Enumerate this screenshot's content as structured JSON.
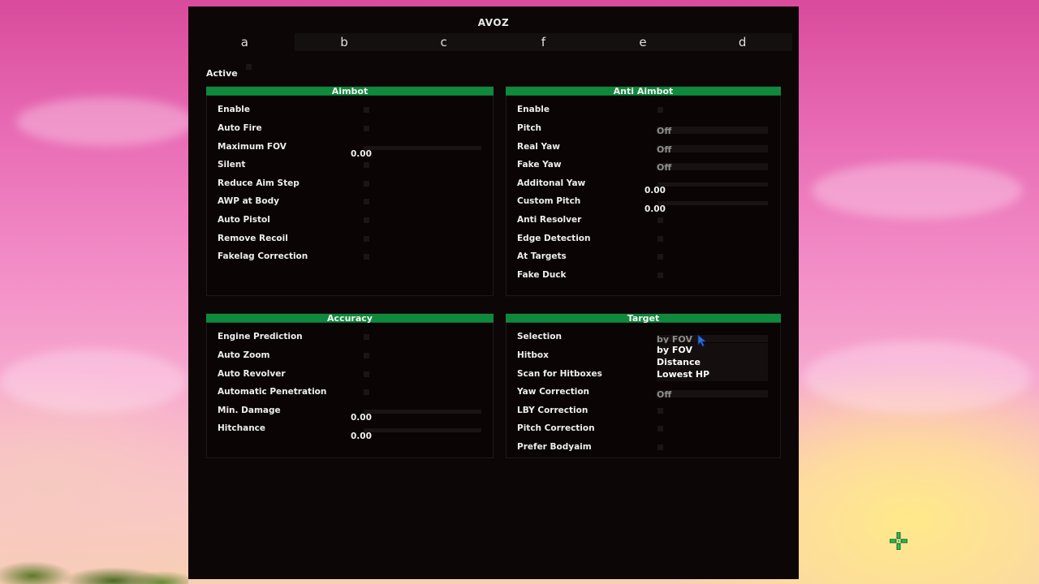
{
  "window": {
    "title": "AVOZ"
  },
  "tabs": [
    "a",
    "b",
    "c",
    "f",
    "e",
    "d"
  ],
  "active_label": "Active",
  "aimbot": {
    "title": "Aimbot",
    "enable": "Enable",
    "auto_fire": "Auto Fire",
    "maximum_fov": "Maximum FOV",
    "maximum_fov_value": "0.00",
    "silent": "Silent",
    "reduce_aim_step": "Reduce Aim Step",
    "awp_at_body": "AWP at Body",
    "auto_pistol": "Auto Pistol",
    "remove_recoil": "Remove Recoil",
    "fakelag_correction": "Fakelag Correction"
  },
  "anti_aimbot": {
    "title": "Anti Aimbot",
    "enable": "Enable",
    "pitch": "Pitch",
    "pitch_value": "Off",
    "real_yaw": "Real Yaw",
    "real_yaw_value": "Off",
    "fake_yaw": "Fake Yaw",
    "fake_yaw_value": "Off",
    "additional_yaw": "Additonal Yaw",
    "additional_yaw_value": "0.00",
    "custom_pitch": "Custom Pitch",
    "custom_pitch_value": "0.00",
    "anti_resolver": "Anti Resolver",
    "edge_detection": "Edge Detection",
    "at_targets": "At Targets",
    "fake_duck": "Fake Duck"
  },
  "accuracy": {
    "title": "Accuracy",
    "engine_prediction": "Engine Prediction",
    "auto_zoom": "Auto Zoom",
    "auto_revolver": "Auto Revolver",
    "automatic_penetration": "Automatic Penetration",
    "min_damage": "Min. Damage",
    "min_damage_value": "0.00",
    "hitchance": "Hitchance",
    "hitchance_value": "0.00"
  },
  "target": {
    "title": "Target",
    "selection": "Selection",
    "selection_value": "by FOV",
    "selection_options": [
      "by FOV",
      "Distance",
      "Lowest HP"
    ],
    "hitbox": "Hitbox",
    "scan_for_hitboxes": "Scan for Hitboxes",
    "yaw_correction": "Yaw Correction",
    "yaw_correction_value": "Off",
    "lby_correction": "LBY Correction",
    "pitch_correction": "Pitch Correction",
    "prefer_bodyaim": "Prefer Bodyaim"
  },
  "colors": {
    "accent": "#0f8a3c",
    "window_bg": "#0d0606"
  },
  "icons": {
    "cursor": "mouse-pointer-icon",
    "crosshair": "crosshair-icon"
  }
}
